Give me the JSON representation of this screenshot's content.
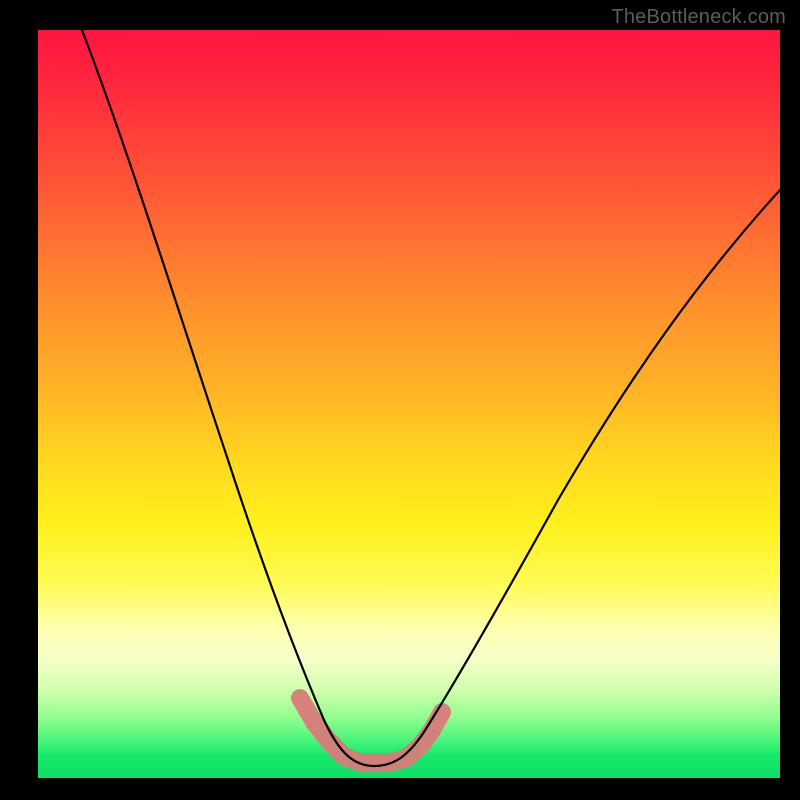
{
  "watermark": "TheBottleneck.com",
  "chart_data": {
    "type": "line",
    "title": "",
    "xlabel": "",
    "ylabel": "",
    "xlim": [
      0,
      100
    ],
    "ylim": [
      0,
      100
    ],
    "background_gradient": {
      "orientation": "vertical",
      "stops": [
        {
          "pos": 0,
          "color": "#ff1540"
        },
        {
          "pos": 50,
          "color": "#ffc822"
        },
        {
          "pos": 78,
          "color": "#ffff80"
        },
        {
          "pos": 100,
          "color": "#18e86c"
        }
      ]
    },
    "series": [
      {
        "name": "bottleneck-curve",
        "color": "#000000",
        "x": [
          5,
          10,
          15,
          20,
          25,
          30,
          34,
          37,
          40,
          43,
          46,
          50,
          55,
          60,
          65,
          70,
          75,
          80,
          85,
          90,
          95,
          100
        ],
        "y": [
          100,
          85,
          71,
          57,
          43,
          30,
          19,
          11,
          5,
          2,
          1,
          1,
          2,
          5,
          10,
          17,
          24,
          32,
          40,
          48,
          55,
          62
        ]
      }
    ],
    "highlight_segment": {
      "name": "optimal-range",
      "color": "#d97a7a",
      "x": [
        37,
        40,
        43,
        46,
        50,
        53
      ],
      "y": [
        10,
        4,
        1.5,
        1,
        1,
        3
      ]
    }
  }
}
